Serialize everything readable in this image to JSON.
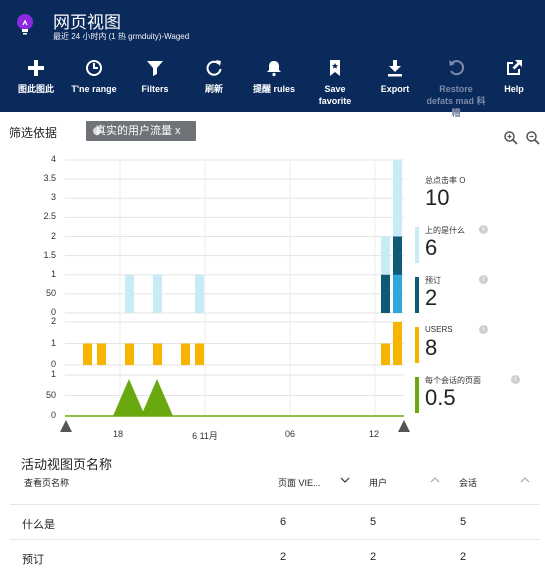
{
  "header": {
    "title": "网页视图",
    "subtitle": "最近 24 小时内 (1 热 grmduity)-Waged",
    "icon": "lightbulb-icon",
    "accent": "#0a2a5c"
  },
  "toolbar": [
    {
      "name": "add-button",
      "label": "图此图此",
      "icon": "plus-icon",
      "enabled": true
    },
    {
      "name": "time-range-button",
      "label": "T'ne  range",
      "icon": "clock-icon",
      "enabled": true
    },
    {
      "name": "filters-button",
      "label": "Filters",
      "icon": "filter-icon",
      "enabled": true
    },
    {
      "name": "refresh-button",
      "label": "刷新",
      "icon": "refresh-icon",
      "enabled": true
    },
    {
      "name": "alert-rules-button",
      "label": "提醒  rules",
      "icon": "bell-icon",
      "enabled": true
    },
    {
      "name": "save-favorite-button",
      "label": "Save\nfavorite",
      "icon": "bookmark-icon",
      "enabled": true
    },
    {
      "name": "export-button",
      "label": "Export",
      "icon": "download-icon",
      "enabled": true
    },
    {
      "name": "restore-defaults-button",
      "label": "Restore\ndefats  mad 科糟",
      "icon": "undo-icon",
      "enabled": false
    },
    {
      "name": "help-button",
      "label": "Help",
      "icon": "external-link-icon",
      "enabled": true
    }
  ],
  "filters": {
    "label": "筛选依据",
    "chip_text": "真实的用户流量 x"
  },
  "charts": {
    "x_ticks": [
      "18",
      "6 11月",
      "06",
      "12"
    ],
    "panel1": {
      "y_ticks": [
        "4",
        "3.5",
        "3",
        "2.5",
        "2",
        "1.5",
        "1",
        "50",
        "0"
      ]
    },
    "panel2": {
      "y_ticks": [
        "2",
        "1",
        "0"
      ]
    },
    "panel3": {
      "y_ticks": [
        "1",
        "50",
        "0"
      ]
    },
    "colors": {
      "light": "#c8ebf8",
      "dark": "#0f5a75",
      "mid": "#2ea8da",
      "gold": "#f7b500",
      "green": "#6aa810"
    }
  },
  "chart_data": [
    {
      "type": "bar",
      "series": [
        {
          "name": "总点击率",
          "values": [
            1,
            1,
            1,
            1,
            4
          ]
        },
        {
          "name": "上的是什么",
          "values": [
            0,
            0,
            0,
            0,
            2
          ]
        },
        {
          "name": "预订",
          "values": [
            0,
            0,
            0,
            0,
            2
          ]
        }
      ],
      "ylim": [
        0,
        4
      ]
    },
    {
      "type": "bar",
      "series": [
        {
          "name": "USERS",
          "values": [
            1,
            1,
            1,
            1,
            1,
            1,
            1,
            1,
            2
          ]
        }
      ],
      "ylim": [
        0,
        2
      ]
    },
    {
      "type": "area",
      "series": [
        {
          "name": "每个会话的页面",
          "values": [
            0,
            1,
            0,
            1,
            0
          ]
        }
      ],
      "ylim": [
        0,
        1
      ]
    }
  ],
  "metrics": [
    {
      "label": "总点击率 O",
      "value": "10",
      "color": "#ffffff"
    },
    {
      "label": "上的是什么",
      "value": "6",
      "color": "#c8ebf8"
    },
    {
      "label": "预订",
      "value": "2",
      "color": "#0f5a75"
    },
    {
      "label": "USERS",
      "value": "8",
      "color": "#f7b500"
    },
    {
      "label": "每个会话的页面",
      "value": "0.5",
      "color": "#6aa810"
    }
  ],
  "table": {
    "title": "活动视图页名称",
    "columns": [
      "查看页名称",
      "页面 VIE...",
      "用户",
      "会话"
    ],
    "rows": [
      [
        "什么是",
        "6",
        "5",
        "5"
      ],
      [
        "预订",
        "2",
        "2",
        "2"
      ]
    ]
  }
}
